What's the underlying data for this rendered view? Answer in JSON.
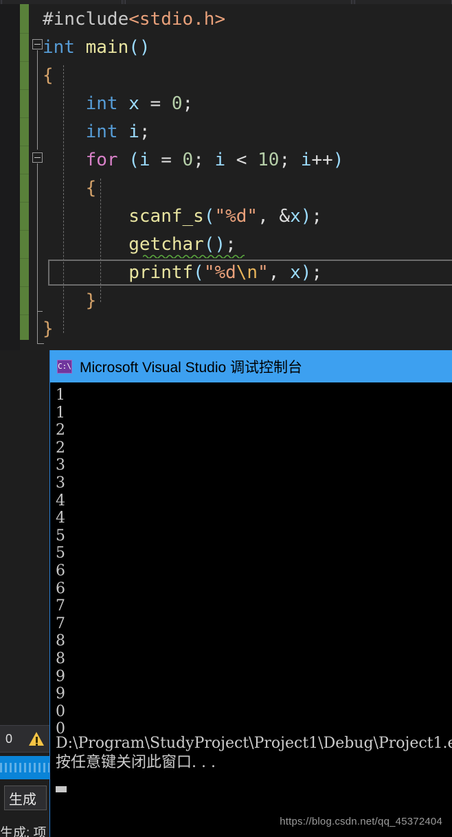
{
  "editor": {
    "language": "c",
    "code_lines": [
      {
        "indent": 0,
        "tokens": [
          {
            "t": "#include",
            "c": "pp"
          },
          {
            "t": "<stdio.h>",
            "c": "str"
          }
        ]
      },
      {
        "indent": 0,
        "tokens": [
          {
            "t": "int",
            "c": "kw"
          },
          {
            "t": " ",
            "c": "punct"
          },
          {
            "t": "main",
            "c": "fn"
          },
          {
            "t": "()",
            "c": "paren"
          }
        ]
      },
      {
        "indent": 0,
        "tokens": [
          {
            "t": "{",
            "c": "brace"
          }
        ]
      },
      {
        "indent": 1,
        "tokens": [
          {
            "t": "int",
            "c": "kw"
          },
          {
            "t": " ",
            "c": "punct"
          },
          {
            "t": "x",
            "c": "var"
          },
          {
            "t": " = ",
            "c": "punct"
          },
          {
            "t": "0",
            "c": "num"
          },
          {
            "t": ";",
            "c": "punct"
          }
        ]
      },
      {
        "indent": 1,
        "tokens": [
          {
            "t": "int",
            "c": "kw"
          },
          {
            "t": " ",
            "c": "punct"
          },
          {
            "t": "i",
            "c": "var"
          },
          {
            "t": ";",
            "c": "punct"
          }
        ]
      },
      {
        "indent": 1,
        "tokens": [
          {
            "t": "for",
            "c": "kwc"
          },
          {
            "t": " ",
            "c": "punct"
          },
          {
            "t": "(",
            "c": "paren"
          },
          {
            "t": "i",
            "c": "var"
          },
          {
            "t": " = ",
            "c": "punct"
          },
          {
            "t": "0",
            "c": "num"
          },
          {
            "t": "; ",
            "c": "punct"
          },
          {
            "t": "i",
            "c": "var"
          },
          {
            "t": " < ",
            "c": "punct"
          },
          {
            "t": "10",
            "c": "num"
          },
          {
            "t": "; ",
            "c": "punct"
          },
          {
            "t": "i",
            "c": "var"
          },
          {
            "t": "++",
            "c": "punct"
          },
          {
            "t": ")",
            "c": "paren"
          }
        ]
      },
      {
        "indent": 1,
        "tokens": [
          {
            "t": "{",
            "c": "brace"
          }
        ]
      },
      {
        "indent": 2,
        "tokens": [
          {
            "t": "scanf_s",
            "c": "fn"
          },
          {
            "t": "(",
            "c": "paren"
          },
          {
            "t": "\"%d\"",
            "c": "str"
          },
          {
            "t": ", ",
            "c": "punct"
          },
          {
            "t": "&",
            "c": "punct"
          },
          {
            "t": "x",
            "c": "var"
          },
          {
            "t": ")",
            "c": "paren"
          },
          {
            "t": ";",
            "c": "punct"
          }
        ]
      },
      {
        "indent": 2,
        "tokens": [
          {
            "t": "getchar",
            "c": "fn"
          },
          {
            "t": "()",
            "c": "paren"
          },
          {
            "t": ";",
            "c": "punct"
          }
        ]
      },
      {
        "indent": 2,
        "tokens": [
          {
            "t": "printf",
            "c": "fn"
          },
          {
            "t": "(",
            "c": "paren"
          },
          {
            "t": "\"%d",
            "c": "str"
          },
          {
            "t": "\\n",
            "c": "esc"
          },
          {
            "t": "\"",
            "c": "str"
          },
          {
            "t": ", ",
            "c": "punct"
          },
          {
            "t": "x",
            "c": "var"
          },
          {
            "t": ")",
            "c": "paren"
          },
          {
            "t": ";",
            "c": "punct"
          }
        ]
      },
      {
        "indent": 1,
        "tokens": [
          {
            "t": "}",
            "c": "brace"
          }
        ]
      },
      {
        "indent": 0,
        "tokens": [
          {
            "t": "}",
            "c": "brace"
          }
        ]
      }
    ],
    "fold_markers": [
      "collapse-main",
      "collapse-for"
    ],
    "error_squiggle_on_line": "getchar();",
    "current_line": "printf(\"%d\\n\", x);",
    "colors": {
      "background": "#1f1f1f",
      "change_bar": "#59813a",
      "keyword": "#569cd6",
      "control_keyword": "#d881c8",
      "function": "#e8e4a0",
      "string": "#e8a07a",
      "escape": "#e8b45a",
      "identifier": "#9cdcfe",
      "number": "#b5cea8",
      "preprocessor": "#c8c8c8",
      "squiggle": "#5ba83f",
      "current_line_border": "#6b6b6b"
    }
  },
  "console": {
    "title": "Microsoft Visual Studio 调试控制台",
    "icon": "console-app-icon",
    "icon_glyph": "C:\\",
    "titlebar_color": "#3da0f0",
    "background": "#000000",
    "output_numbers": [
      "1",
      "1",
      "2",
      "2",
      "3",
      "3",
      "4",
      "4",
      "5",
      "5",
      "6",
      "6",
      "7",
      "7",
      "8",
      "8",
      "9",
      "9",
      "0",
      "0"
    ],
    "exit_line": "D:\\Program\\StudyProject\\Project1\\Debug\\Project1.e",
    "press_any_key_line": "按任意键关闭此窗口. . ."
  },
  "left_panel": {
    "error_count": "0",
    "warning_icon": "warning-triangle-icon",
    "build_dropdown_label": "生成",
    "output_label": "生成: 项"
  },
  "watermark": {
    "text": "https://blog.csdn.net/qq_45372404"
  }
}
